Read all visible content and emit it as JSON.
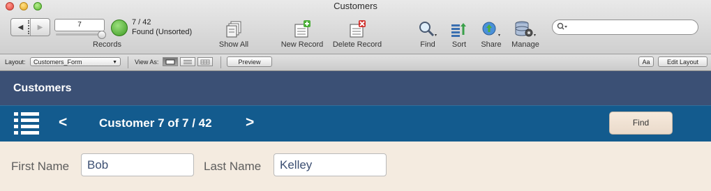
{
  "window": {
    "title": "Customers"
  },
  "toolbar": {
    "record_number": "7",
    "record_count": "7 / 42",
    "found_status": "Found (Unsorted)",
    "records_label": "Records",
    "show_all": "Show All",
    "new_record": "New Record",
    "delete_record": "Delete Record",
    "find": "Find",
    "sort": "Sort",
    "share": "Share",
    "manage": "Manage",
    "search_placeholder": ""
  },
  "layoutbar": {
    "layout_label": "Layout:",
    "layout_value": "Customers_Form",
    "view_as_label": "View As:",
    "preview": "Preview",
    "text_format": "Aa",
    "edit_layout": "Edit Layout"
  },
  "header": {
    "title": "Customers"
  },
  "navbar": {
    "prev": "<",
    "title": "Customer 7 of 7 / 42",
    "next": ">",
    "find_button": "Find"
  },
  "form": {
    "first_name_label": "First Name",
    "first_name_value": "Bob",
    "last_name_label": "Last Name",
    "last_name_value": "Kelley"
  },
  "colors": {
    "header_bg": "#3b5075",
    "navbar_bg": "#135b8e",
    "body_bg": "#f4ebe0",
    "field_text": "#3c4f72"
  }
}
